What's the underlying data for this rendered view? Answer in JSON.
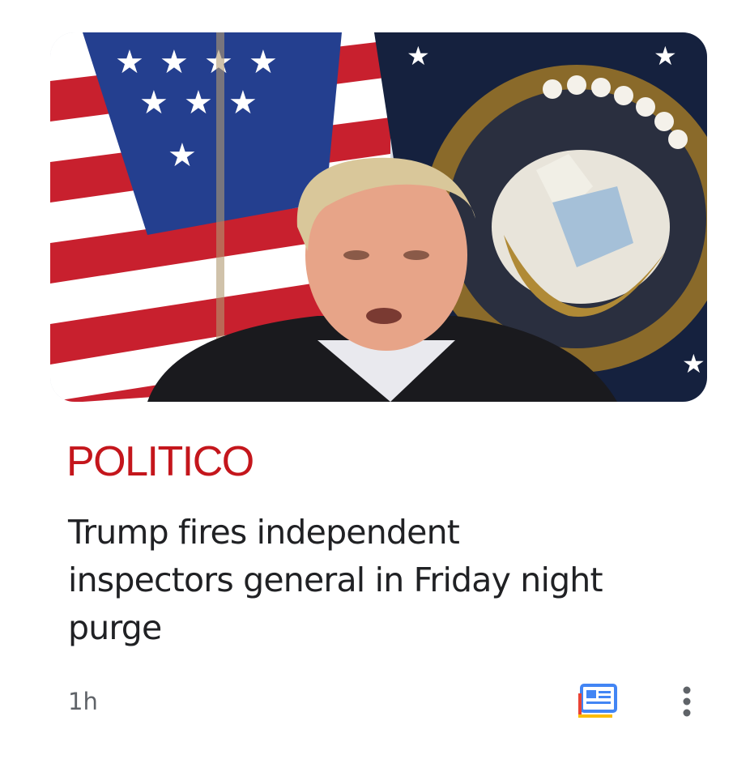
{
  "card": {
    "source_name": "POLITICO",
    "source_color": "#c4161c",
    "headline": "Trump fires independent\ninspectors general in Friday night\npurge",
    "time_ago": "1h"
  },
  "thumbnail": {
    "subject": "photo-of-speaker-in-front-of-us-flag-and-presidential-seal"
  },
  "actions": {
    "news_icon": "google-news-icon",
    "more_icon": "more-vert-icon"
  },
  "colors": {
    "headline": "#202124",
    "meta": "#5f6368",
    "icon_blue": "#4285f4",
    "icon_red": "#ea4335",
    "icon_yellow": "#fbbc04",
    "more_dots": "#5f6368"
  }
}
